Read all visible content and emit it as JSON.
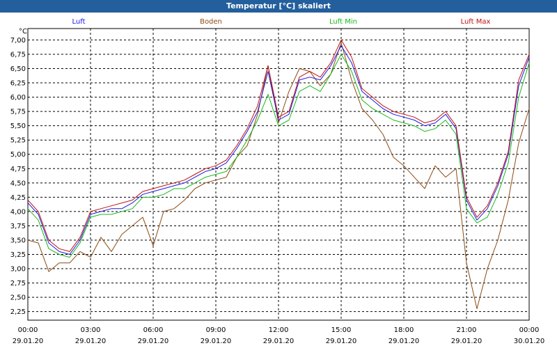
{
  "window_title": "Temperatur [°C] skaliert",
  "colors": {
    "title_bg": "#235f9c",
    "luft": "#1a1adf",
    "boden": "#8b4a10",
    "luft_min": "#18b818",
    "luft_max": "#c01010",
    "grid": "#000000"
  },
  "chart_data": {
    "type": "line",
    "title": "Temperatur [°C] skaliert",
    "ylabel": "°C",
    "xlabel": "",
    "ylim": [
      2.1,
      7.2
    ],
    "xlim": [
      0,
      24
    ],
    "y_ticks": [
      "7,00",
      "6,75",
      "6,50",
      "6,25",
      "6,00",
      "5,75",
      "5,50",
      "5,25",
      "5,00",
      "4,75",
      "4,50",
      "4,25",
      "4,00",
      "3,75",
      "3,50",
      "3,25",
      "3,00",
      "2,75",
      "2,50",
      "2,25"
    ],
    "x_ticks": [
      {
        "time": "00:00",
        "date": "29.01.20"
      },
      {
        "time": "03:00",
        "date": "29.01.20"
      },
      {
        "time": "06:00",
        "date": "29.01.20"
      },
      {
        "time": "09:00",
        "date": "29.01.20"
      },
      {
        "time": "12:00",
        "date": "29.01.20"
      },
      {
        "time": "15:00",
        "date": "29.01.20"
      },
      {
        "time": "18:00",
        "date": "29.01.20"
      },
      {
        "time": "21:00",
        "date": "29.01.20"
      },
      {
        "time": "00:00",
        "date": "30.01.20"
      }
    ],
    "legend": [
      "Luft",
      "Boden",
      "Luft Min",
      "Luft Max"
    ],
    "grid": true,
    "series": [
      {
        "name": "Luft",
        "x_hours": [
          0,
          0.5,
          1,
          1.5,
          2,
          2.5,
          3,
          3.5,
          4,
          4.5,
          5,
          5.5,
          6,
          6.5,
          7,
          7.5,
          8,
          8.5,
          9,
          9.5,
          10,
          10.5,
          11,
          11.5,
          12,
          12.5,
          13,
          13.5,
          14,
          14.5,
          15,
          15.5,
          16,
          16.5,
          17,
          17.5,
          18,
          18.5,
          19,
          19.5,
          20,
          20.5,
          21,
          21.5,
          22,
          22.5,
          23,
          23.5,
          24
        ],
        "values": [
          4.15,
          3.95,
          3.45,
          3.3,
          3.25,
          3.5,
          3.95,
          4.0,
          4.05,
          4.05,
          4.15,
          4.3,
          4.35,
          4.4,
          4.45,
          4.5,
          4.6,
          4.7,
          4.75,
          4.85,
          5.1,
          5.4,
          5.75,
          6.45,
          5.6,
          5.7,
          6.3,
          6.35,
          6.3,
          6.55,
          6.9,
          6.6,
          6.1,
          5.95,
          5.8,
          5.7,
          5.65,
          5.6,
          5.5,
          5.55,
          5.7,
          5.45,
          4.2,
          3.85,
          4.05,
          4.45,
          5.0,
          6.2,
          6.7
        ]
      },
      {
        "name": "Boden",
        "x_hours": [
          0,
          0.5,
          1,
          1.5,
          2,
          2.5,
          3,
          3.5,
          4,
          4.5,
          5,
          5.5,
          6,
          6.5,
          7,
          7.5,
          8,
          8.5,
          9,
          9.5,
          10,
          10.5,
          11,
          11.5,
          12,
          12.5,
          13,
          13.5,
          14,
          14.5,
          15,
          15.5,
          16,
          16.5,
          17,
          17.5,
          18,
          18.5,
          19,
          19.5,
          20,
          20.5,
          21,
          21.5,
          22,
          22.5,
          23,
          23.5,
          24
        ],
        "values": [
          3.5,
          3.45,
          2.95,
          3.1,
          3.1,
          3.3,
          3.2,
          3.55,
          3.3,
          3.6,
          3.75,
          3.9,
          3.4,
          4.0,
          4.05,
          4.2,
          4.4,
          4.5,
          4.55,
          4.6,
          4.95,
          5.15,
          5.7,
          6.55,
          5.55,
          6.1,
          6.5,
          6.45,
          6.2,
          6.4,
          6.95,
          6.3,
          5.8,
          5.6,
          5.35,
          4.95,
          4.8,
          4.6,
          4.4,
          4.8,
          4.6,
          4.75,
          3.1,
          2.3,
          3.0,
          3.5,
          4.2,
          5.2,
          5.8
        ]
      },
      {
        "name": "Luft Min",
        "x_hours": [
          0,
          0.5,
          1,
          1.5,
          2,
          2.5,
          3,
          3.5,
          4,
          4.5,
          5,
          5.5,
          6,
          6.5,
          7,
          7.5,
          8,
          8.5,
          9,
          9.5,
          10,
          10.5,
          11,
          11.5,
          12,
          12.5,
          13,
          13.5,
          14,
          14.5,
          15,
          15.5,
          16,
          16.5,
          17,
          17.5,
          18,
          18.5,
          19,
          19.5,
          20,
          20.5,
          21,
          21.5,
          22,
          22.5,
          23,
          23.5,
          24
        ],
        "values": [
          4.05,
          3.85,
          3.35,
          3.25,
          3.2,
          3.45,
          3.9,
          3.95,
          3.95,
          4.0,
          4.05,
          4.25,
          4.25,
          4.3,
          4.4,
          4.4,
          4.5,
          4.6,
          4.65,
          4.7,
          4.95,
          5.25,
          5.6,
          6.05,
          5.5,
          5.6,
          6.1,
          6.2,
          6.1,
          6.4,
          6.75,
          6.45,
          5.95,
          5.8,
          5.7,
          5.6,
          5.55,
          5.5,
          5.4,
          5.45,
          5.6,
          5.35,
          4.05,
          3.8,
          3.9,
          4.3,
          4.85,
          6.0,
          6.6
        ]
      },
      {
        "name": "Luft Max",
        "x_hours": [
          0,
          0.5,
          1,
          1.5,
          2,
          2.5,
          3,
          3.5,
          4,
          4.5,
          5,
          5.5,
          6,
          6.5,
          7,
          7.5,
          8,
          8.5,
          9,
          9.5,
          10,
          10.5,
          11,
          11.5,
          12,
          12.5,
          13,
          13.5,
          14,
          14.5,
          15,
          15.5,
          16,
          16.5,
          17,
          17.5,
          18,
          18.5,
          19,
          19.5,
          20,
          20.5,
          21,
          21.5,
          22,
          22.5,
          23,
          23.5,
          24
        ],
        "values": [
          4.2,
          4.0,
          3.5,
          3.35,
          3.3,
          3.55,
          4.0,
          4.05,
          4.1,
          4.15,
          4.2,
          4.35,
          4.4,
          4.45,
          4.5,
          4.55,
          4.65,
          4.75,
          4.8,
          4.9,
          5.15,
          5.45,
          5.85,
          6.55,
          5.65,
          5.75,
          6.35,
          6.45,
          6.35,
          6.6,
          7.0,
          6.7,
          6.15,
          6.0,
          5.85,
          5.75,
          5.7,
          5.65,
          5.55,
          5.6,
          5.75,
          5.5,
          4.25,
          3.9,
          4.1,
          4.5,
          5.05,
          6.3,
          6.75
        ]
      }
    ]
  }
}
